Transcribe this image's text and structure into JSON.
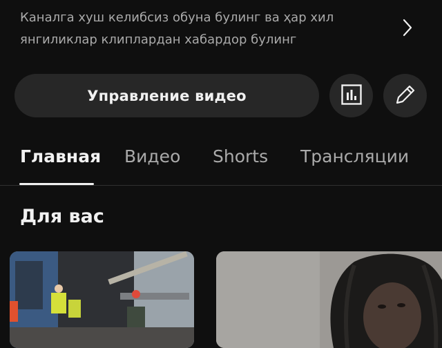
{
  "channel": {
    "description_line1": "Каналга хуш келибсиз обуна булинг  ва ҳар хил",
    "description_line2": "янгиликлар клиплардан хабардор булинг",
    "description_arrow_icon": "chevron-right-icon"
  },
  "actions": {
    "manage_label": "Управление видео",
    "analytics_icon": "analytics-icon",
    "edit_icon": "pencil-icon"
  },
  "tabs": [
    {
      "label": "Главная",
      "active": true
    },
    {
      "label": "Видео",
      "active": false
    },
    {
      "label": "Shorts",
      "active": false
    },
    {
      "label": "Трансляции",
      "active": false
    }
  ],
  "section": {
    "title": "Для вас"
  },
  "colors": {
    "background": "#0f0f0f",
    "button_bg": "#272727",
    "text_primary": "#f1f1f1",
    "text_secondary": "#aaaaaa"
  }
}
